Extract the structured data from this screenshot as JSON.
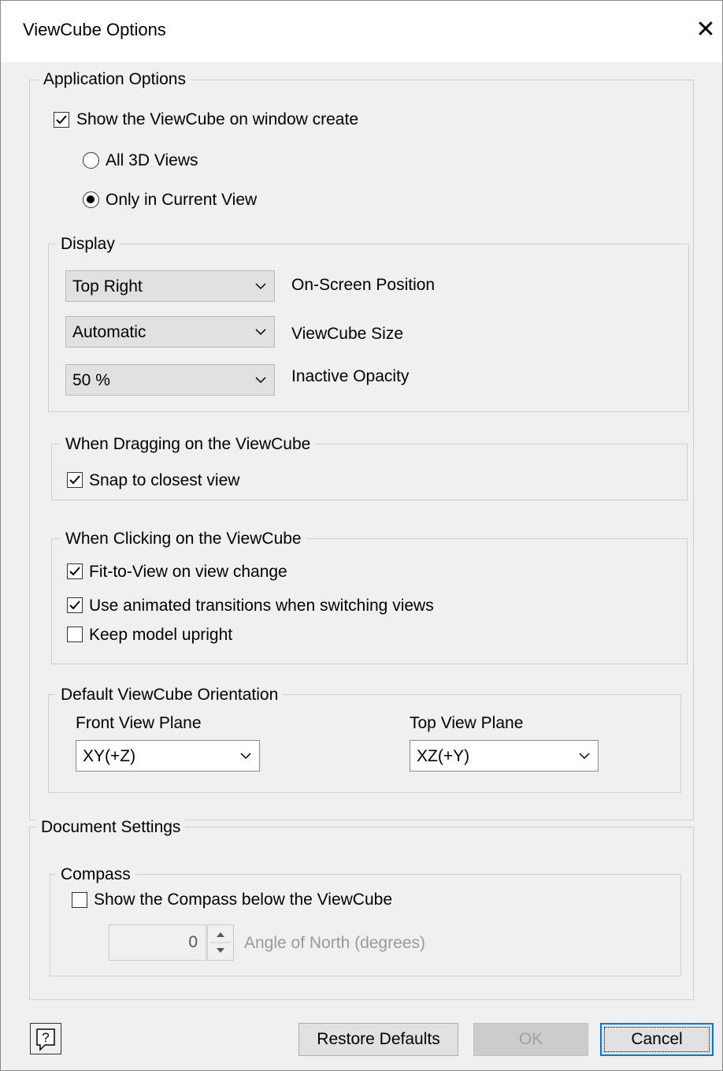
{
  "dialog": {
    "title": "ViewCube Options",
    "close_glyph": "✕"
  },
  "application_options": {
    "legend": "Application Options",
    "show_viewcube": {
      "label": "Show the ViewCube on window create",
      "checked": true
    },
    "radio_all": {
      "label": "All 3D Views",
      "selected": false
    },
    "radio_current": {
      "label": "Only in Current View",
      "selected": true
    },
    "display": {
      "legend": "Display",
      "position": {
        "value": "Top Right",
        "label": "On-Screen Position"
      },
      "size": {
        "value": "Automatic",
        "label": "ViewCube Size"
      },
      "opacity": {
        "value": "50 %",
        "label": "Inactive Opacity"
      }
    },
    "dragging": {
      "legend": "When Dragging on the ViewCube",
      "snap": {
        "label": "Snap to closest view",
        "checked": true
      }
    },
    "clicking": {
      "legend": "When Clicking on the ViewCube",
      "fit": {
        "label": "Fit-to-View on view change",
        "checked": true
      },
      "animated": {
        "label": "Use animated transitions when switching views",
        "checked": true
      },
      "upright": {
        "label": "Keep model upright",
        "checked": false
      }
    },
    "orientation": {
      "legend": "Default ViewCube Orientation",
      "front_label": "Front View Plane",
      "front_value": "XY(+Z)",
      "top_label": "Top View Plane",
      "top_value": "XZ(+Y)"
    }
  },
  "document_settings": {
    "legend": "Document Settings",
    "compass": {
      "legend": "Compass",
      "show": {
        "label": "Show the Compass below the ViewCube",
        "checked": false
      },
      "angle_value": "0",
      "angle_label": "Angle of North (degrees)"
    }
  },
  "footer": {
    "help_glyph": "?",
    "restore": "Restore Defaults",
    "ok": "OK",
    "cancel": "Cancel"
  }
}
